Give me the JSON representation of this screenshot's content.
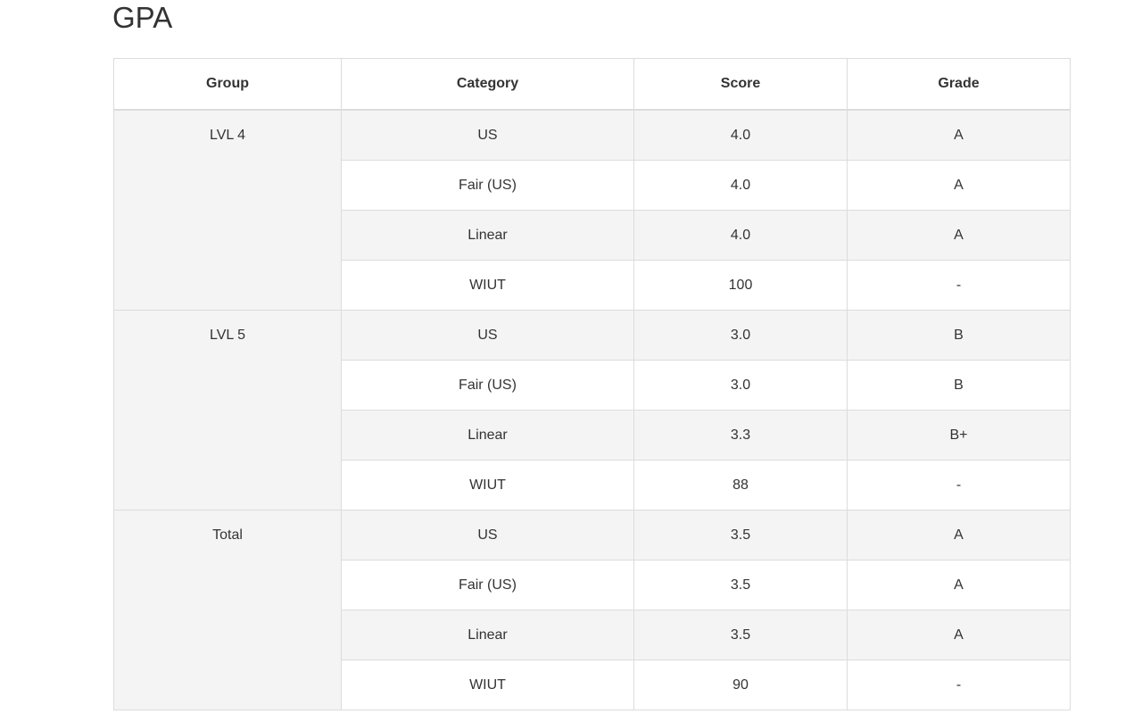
{
  "page": {
    "title": "GPA"
  },
  "table": {
    "headers": {
      "group": "Group",
      "category": "Category",
      "score": "Score",
      "grade": "Grade"
    },
    "groups": [
      {
        "name": "LVL 4",
        "rows": [
          {
            "category": "US",
            "score": "4.0",
            "grade": "A"
          },
          {
            "category": "Fair (US)",
            "score": "4.0",
            "grade": "A"
          },
          {
            "category": "Linear",
            "score": "4.0",
            "grade": "A"
          },
          {
            "category": "WIUT",
            "score": "100",
            "grade": "-"
          }
        ]
      },
      {
        "name": "LVL 5",
        "rows": [
          {
            "category": "US",
            "score": "3.0",
            "grade": "B"
          },
          {
            "category": "Fair (US)",
            "score": "3.0",
            "grade": "B"
          },
          {
            "category": "Linear",
            "score": "3.3",
            "grade": "B+"
          },
          {
            "category": "WIUT",
            "score": "88",
            "grade": "-"
          }
        ]
      },
      {
        "name": "Total",
        "rows": [
          {
            "category": "US",
            "score": "3.5",
            "grade": "A"
          },
          {
            "category": "Fair (US)",
            "score": "3.5",
            "grade": "A"
          },
          {
            "category": "Linear",
            "score": "3.5",
            "grade": "A"
          },
          {
            "category": "WIUT",
            "score": "90",
            "grade": "-"
          }
        ]
      }
    ]
  }
}
